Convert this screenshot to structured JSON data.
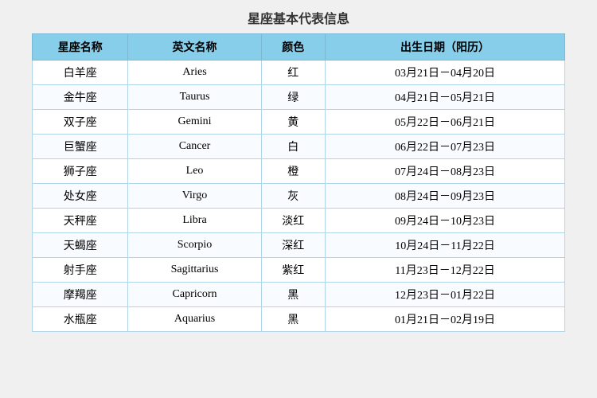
{
  "title": "星座基本代表信息",
  "headers": [
    "星座名称",
    "英文名称",
    "颜色",
    "出生日期（阳历）"
  ],
  "rows": [
    {
      "chinese": "白羊座",
      "english": "Aries",
      "color": "红",
      "date": "03月21日－04月20日"
    },
    {
      "chinese": "金牛座",
      "english": "Taurus",
      "color": "绿",
      "date": "04月21日－05月21日"
    },
    {
      "chinese": "双子座",
      "english": "Gemini",
      "color": "黄",
      "date": "05月22日－06月21日"
    },
    {
      "chinese": "巨蟹座",
      "english": "Cancer",
      "color": "白",
      "date": "06月22日－07月23日"
    },
    {
      "chinese": "狮子座",
      "english": "Leo",
      "color": "橙",
      "date": "07月24日－08月23日"
    },
    {
      "chinese": "处女座",
      "english": "Virgo",
      "color": "灰",
      "date": "08月24日－09月23日"
    },
    {
      "chinese": "天秤座",
      "english": "Libra",
      "color": "淡红",
      "date": "09月24日－10月23日"
    },
    {
      "chinese": "天蝎座",
      "english": "Scorpio",
      "color": "深红",
      "date": "10月24日－11月22日"
    },
    {
      "chinese": "射手座",
      "english": "Sagittarius",
      "color": "紫红",
      "date": "11月23日－12月22日"
    },
    {
      "chinese": "摩羯座",
      "english": "Capricorn",
      "color": "黑",
      "date": "12月23日－01月22日"
    },
    {
      "chinese": "水瓶座",
      "english": "Aquarius",
      "color": "黑",
      "date": "01月21日－02月19日"
    }
  ]
}
